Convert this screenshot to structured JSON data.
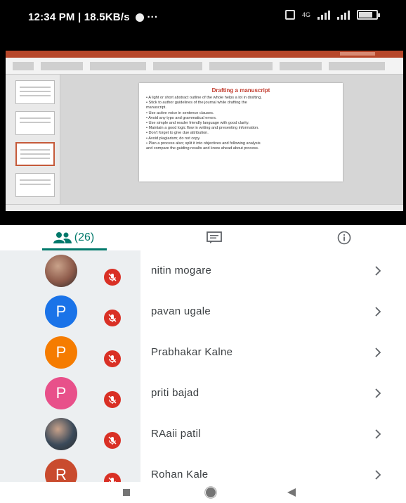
{
  "status_bar": {
    "time": "12:34 PM | 18.5KB/s",
    "extra": "···",
    "network": "4G",
    "battery_level": 0.8
  },
  "slide": {
    "title": "Drafting a manuscript",
    "bullets": [
      "• A light or short abstract outline of the whole helps a lot in drafting.",
      "• Stick to author guidelines of the journal while drafting the",
      "  manuscript.",
      "• Use active voice in sentence clauses.",
      "• Avoid any typo and grammatical errors.",
      "• Use simple and reader friendly language with good clarity.",
      "• Maintain a good logic flow in writing and presenting information.",
      "• Don't forget to give due attribution.",
      "• Avoid plagiarism; do not copy.",
      "• Plan a process also; split it into objectives and following analysis",
      "  and compare the guiding results and know ahead about process."
    ]
  },
  "tabs": {
    "people": {
      "count": "(26)",
      "icon": "people-icon"
    },
    "chat": {
      "icon": "chat-icon"
    },
    "info": {
      "icon": "info-icon"
    }
  },
  "participants": [
    {
      "name": "nitin mogare",
      "initial": "",
      "avatar_type": "photo",
      "color": "#8d5a4a"
    },
    {
      "name": "pavan ugale",
      "initial": "P",
      "avatar_type": "letter",
      "color": "#1a73e8"
    },
    {
      "name": "Prabhakar Kalne",
      "initial": "P",
      "avatar_type": "letter",
      "color": "#f57c00"
    },
    {
      "name": "priti bajad",
      "initial": "P",
      "avatar_type": "letter",
      "color": "#e8508a"
    },
    {
      "name": "RAaii patil",
      "initial": "",
      "avatar_type": "photo",
      "color": "#3b4a5a"
    },
    {
      "name": "Rohan Kale",
      "initial": "R",
      "avatar_type": "letter",
      "color": "#c94b2e"
    }
  ],
  "colors": {
    "accent": "#00796b",
    "mute": "#d93025"
  }
}
